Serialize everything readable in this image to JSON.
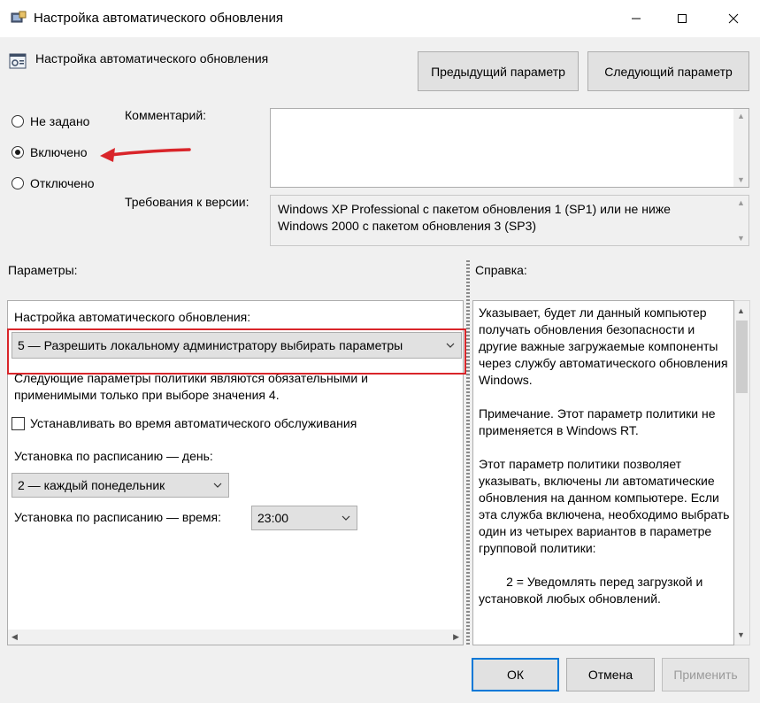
{
  "window": {
    "title": "Настройка автоматического обновления",
    "minimize": "minimize-icon",
    "maximize": "maximize-icon",
    "close": "close-icon"
  },
  "header": {
    "title": "Настройка автоматического обновления",
    "prev_button": "Предыдущий параметр",
    "next_button": "Следующий параметр"
  },
  "state": {
    "options": [
      "Не задано",
      "Включено",
      "Отключено"
    ],
    "selected": "Включено"
  },
  "comment": {
    "label": "Комментарий:",
    "value": ""
  },
  "requirements": {
    "label": "Требования к версии:",
    "text": "Windows XP Professional с пакетом обновления 1 (SP1) или не ниже Windows 2000 с пакетом обновления 3 (SP3)"
  },
  "params": {
    "label": "Параметры:",
    "config_label": "Настройка автоматического обновления:",
    "config_value": "5 — Разрешить локальному администратору выбирать параметры",
    "note": "Следующие параметры политики являются обязательными и применимыми только при выборе значения 4.",
    "maintenance_label": "Устанавливать во время автоматического обслуживания",
    "maintenance_checked": false,
    "day_label": "Установка по расписанию — день:",
    "day_value": "2 — каждый понедельник",
    "time_label": "Установка по расписанию — время:",
    "time_value": "23:00"
  },
  "help": {
    "label": "Справка:",
    "text": "Указывает, будет ли данный компьютер получать обновления безопасности и другие важные загружаемые компоненты через службу автоматического обновления Windows.\n\nПримечание. Этот параметр политики не применяется в Windows RT.\n\nЭтот параметр политики позволяет указывать, включены ли автоматические обновления на данном компьютере. Если эта служба включена, необходимо выбрать один из четырех вариантов в параметре групповой политики:\n\n        2 = Уведомлять перед загрузкой и установкой любых обновлений."
  },
  "footer": {
    "ok": "ОК",
    "cancel": "Отмена",
    "apply": "Применить"
  },
  "colors": {
    "annotation_red": "#d9252a",
    "accent_blue": "#0078d7"
  }
}
